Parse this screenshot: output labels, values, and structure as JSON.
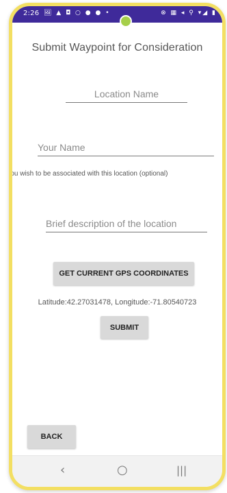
{
  "status_bar": {
    "time": "2:26",
    "left_icons": "🖼 ▲ ◘ ○ ● ● •",
    "right_icons": "⊗ ▦ ◂ ⚲ ▾◢ ▮"
  },
  "form": {
    "title": "Submit Waypoint for Consideration",
    "location_placeholder": "Location Name",
    "name_placeholder": "Your Name",
    "name_hint": "If you wish to be associated with this location (optional)",
    "description_placeholder": "Brief description of the location"
  },
  "actions": {
    "gps_label": "GET CURRENT GPS COORDINATES",
    "coordinates": "Latitude:42.27031478, Longitude:-71.80540723",
    "submit_label": "SUBMIT",
    "back_label": "BACK"
  },
  "nav": {
    "back_glyph": "‹",
    "home_glyph": "○",
    "recents_glyph": "|||"
  },
  "colors": {
    "status_bar": "#3f2a9a",
    "frame_border": "#f3df62",
    "camera_dot": "#a6cf4a",
    "button_bg": "#d9d9d9"
  }
}
